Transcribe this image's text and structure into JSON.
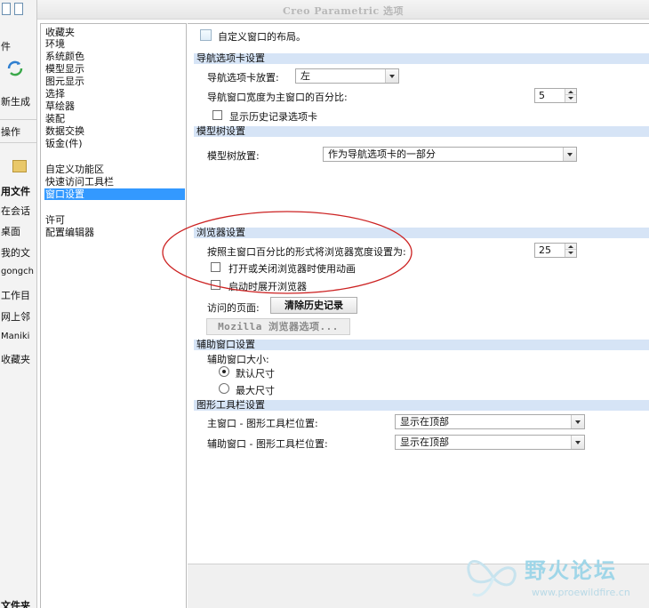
{
  "window": {
    "title": "Creo Parametric 选项"
  },
  "background_app": {
    "items": [
      "件",
      "新生成",
      "操作",
      "用文件",
      "在会话",
      "桌面",
      "我的文",
      "gongch",
      "工作目",
      "网上邻",
      "Maniki",
      "收藏夹",
      "文件夹"
    ]
  },
  "categories": {
    "group1": [
      "收藏夹",
      "环境",
      "系统颜色",
      "模型显示",
      "图元显示",
      "选择",
      "草绘器",
      "装配",
      "数据交换",
      "钣金(件)"
    ],
    "group2": [
      "自定义功能区",
      "快速访问工具栏",
      "窗口设置"
    ],
    "group3": [
      "许可",
      "配置编辑器"
    ],
    "selected": "窗口设置"
  },
  "settings": {
    "customize_layout_label": "自定义窗口的布局。",
    "nav": {
      "header": "导航选项卡设置",
      "position_label": "导航选项卡放置:",
      "position_value": "左",
      "width_label": "导航窗口宽度为主窗口的百分比:",
      "width_value": "5",
      "history_label": "显示历史记录选项卡"
    },
    "tree": {
      "header": "模型树设置",
      "position_label": "模型树放置:",
      "position_value": "作为导航选项卡的一部分"
    },
    "browser": {
      "header": "浏览器设置",
      "width_label": "按照主窗口百分比的形式将浏览器宽度设置为:",
      "width_value": "25",
      "animation_label": "打开或关闭浏览器时使用动画",
      "expand_label": "启动时展开浏览器",
      "visited_label": "访问的页面:",
      "clear_button": "清除历史记录",
      "mozilla_button": "Mozilla 浏览器选项..."
    },
    "aux": {
      "header": "辅助窗口设置",
      "size_label": "辅助窗口大小:",
      "default_label": "默认尺寸",
      "max_label": "最大尺寸",
      "selected": "默认尺寸"
    },
    "toolbar": {
      "header": "图形工具栏设置",
      "main_label": "主窗口 - 图形工具栏位置:",
      "main_value": "显示在顶部",
      "aux_label": "辅助窗口 - 图形工具栏位置:",
      "aux_value": "显示在顶部"
    }
  },
  "watermark": {
    "name": "野火论坛",
    "url": "www.proewildfire.cn"
  },
  "colors": {
    "section_bar": "#d6e4f6",
    "selection": "#3399ff",
    "annotation": "#cc2222",
    "watermark": "#9fd6e8"
  }
}
